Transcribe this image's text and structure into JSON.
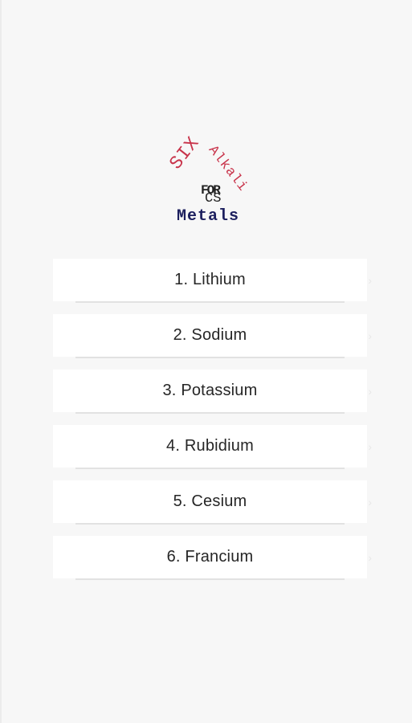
{
  "logo": {
    "six": "SIX",
    "alkali": "Alkali",
    "for": "FOR",
    "cs": "CS",
    "metals": "Metals"
  },
  "menu": {
    "items": [
      {
        "label": "1. Lithium"
      },
      {
        "label": "2. Sodium"
      },
      {
        "label": "3. Potassium"
      },
      {
        "label": "4. Rubidium"
      },
      {
        "label": "5. Cesium"
      },
      {
        "label": "6. Francium"
      }
    ],
    "chevron_icon": "chevron-right-icon"
  },
  "colors": {
    "background": "#f7f7f7",
    "card": "#ffffff",
    "logo_red": "#c8334a",
    "logo_navy": "#1c1f5e",
    "text": "#262626"
  }
}
